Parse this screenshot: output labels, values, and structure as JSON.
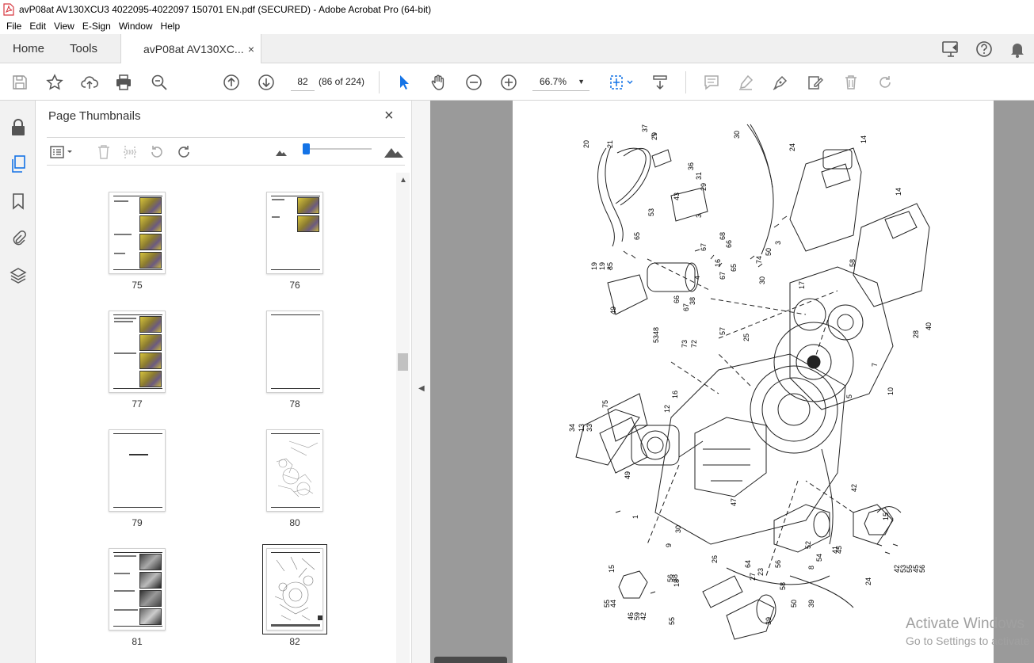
{
  "window": {
    "title": "avP08at AV130XCU3 4022095-4022097 150701 EN.pdf (SECURED) - Adobe Acrobat Pro (64-bit)"
  },
  "menu": [
    "File",
    "Edit",
    "View",
    "E-Sign",
    "Window",
    "Help"
  ],
  "tabs": {
    "home": "Home",
    "tools": "Tools",
    "doc": "avP08at AV130XC...",
    "doc_close": "×"
  },
  "toolbar": {
    "page_number": "82",
    "page_count": "(86 of 224)",
    "zoom": "66.7%",
    "zoom_caret": "▼"
  },
  "panel": {
    "title": "Page Thumbnails",
    "close": "×",
    "thumbnails": [
      {
        "label": "75",
        "kind": "photos4"
      },
      {
        "label": "76",
        "kind": "photos2"
      },
      {
        "label": "77",
        "kind": "photos4"
      },
      {
        "label": "78",
        "kind": "blank"
      },
      {
        "label": "79",
        "kind": "chapter"
      },
      {
        "label": "80",
        "kind": "drawing"
      },
      {
        "label": "81",
        "kind": "photos4"
      },
      {
        "label": "82",
        "kind": "drawing-dark",
        "selected": true
      }
    ]
  },
  "watermark": {
    "line1": "Activate Windows",
    "line2": "Go to Settings to activate"
  },
  "diagram_labels": [
    "37",
    "29",
    "21",
    "20",
    "30",
    "24",
    "14",
    "14",
    "36",
    "31",
    "29",
    "43",
    "53",
    "3",
    "68",
    "66",
    "67",
    "65",
    "19",
    "19",
    "35",
    "49",
    "4",
    "16",
    "67",
    "65",
    "66",
    "67",
    "38",
    "50",
    "3",
    "74",
    "30",
    "17",
    "58",
    "40",
    "28",
    "48",
    "53",
    "73",
    "72",
    "25",
    "57",
    "7",
    "16",
    "12",
    "75",
    "10",
    "5",
    "34",
    "13",
    "33",
    "49",
    "47",
    "1",
    "30",
    "9",
    "26",
    "24",
    "42",
    "15",
    "8",
    "54",
    "52",
    "41",
    "45",
    "56",
    "64",
    "15",
    "55",
    "44",
    "38",
    "56",
    "18",
    "27",
    "23",
    "39",
    "58",
    "46",
    "59",
    "42",
    "55",
    "39",
    "50",
    "56",
    "45",
    "55",
    "53",
    "42"
  ]
}
